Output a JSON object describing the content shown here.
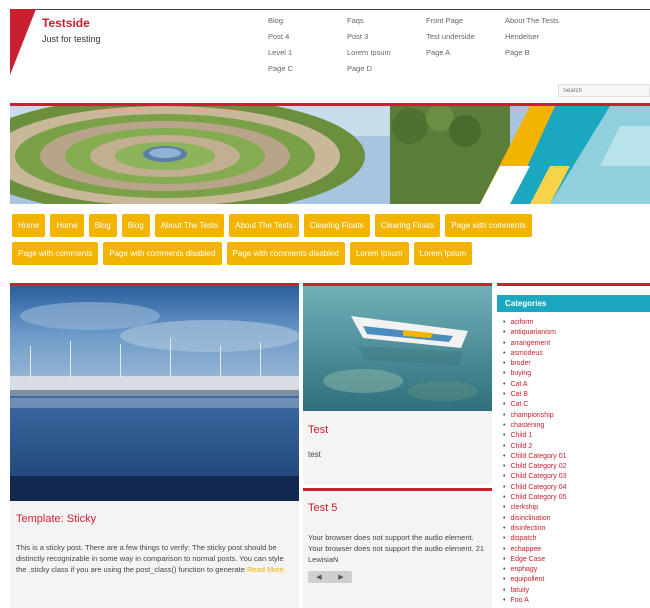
{
  "site": {
    "title": "Testside",
    "description": "Just for testing"
  },
  "topnav": [
    "Blog",
    "Faqs",
    "Front Page",
    "About The Tests",
    "Post 4",
    "Post 3",
    "Test underside",
    "Hendelser",
    "Level 1",
    "Lorem Ipsum",
    "Page A",
    "Page B",
    "Page C",
    "Page D"
  ],
  "search": {
    "placeholder": "Search"
  },
  "menu": {
    "row1": [
      "Home",
      "Home",
      "Blog",
      "Blog",
      "About The Tests",
      "About The Tests",
      "Clearing Floats",
      "Clearing Floats",
      "Page with comments"
    ],
    "row2": [
      "Page with comments",
      "Page with comments disabled",
      "Page with comments disabled",
      "Lorem Ipsum",
      "Lorem Ipsum"
    ]
  },
  "posts": {
    "sticky": {
      "title": "Template: Sticky",
      "excerpt": "This is a sticky post. There are a few things to verify: The sticky post should be distinctly recognizable in some way in comparison to normal posts. You can style the .sticky class if you are using the post_class() function to generate ",
      "read_more": "Read More"
    },
    "test": {
      "title": "Test",
      "excerpt": "test"
    },
    "test5": {
      "title": "Test 5",
      "excerpt": "Your browser does not support the audio element. Your browser does not support the audio element. 21 LewisiaN",
      "audio_prev": "◀",
      "audio_next": "▶"
    }
  },
  "sidebar": {
    "heading": "Categories",
    "categories": [
      "aciform",
      "antiquarianism",
      "arrangement",
      "asmodeus",
      "broder",
      "buying",
      "Cat A",
      "Cat B",
      "Cat C",
      "championship",
      "chastening",
      "Child 1",
      "Child 2",
      "Child Category 01",
      "Child Category 02",
      "Child Category 03",
      "Child Category 04",
      "Child Category 05",
      "clerkship",
      "disinclination",
      "disinfection",
      "dispatch",
      "echappee",
      "Edge Case",
      "enphagy",
      "equipollent",
      "fatuity",
      "Foo A"
    ]
  },
  "colors": {
    "accent": "#c8202f",
    "menu": "#f2b400",
    "widget": "#1aa7bf"
  }
}
